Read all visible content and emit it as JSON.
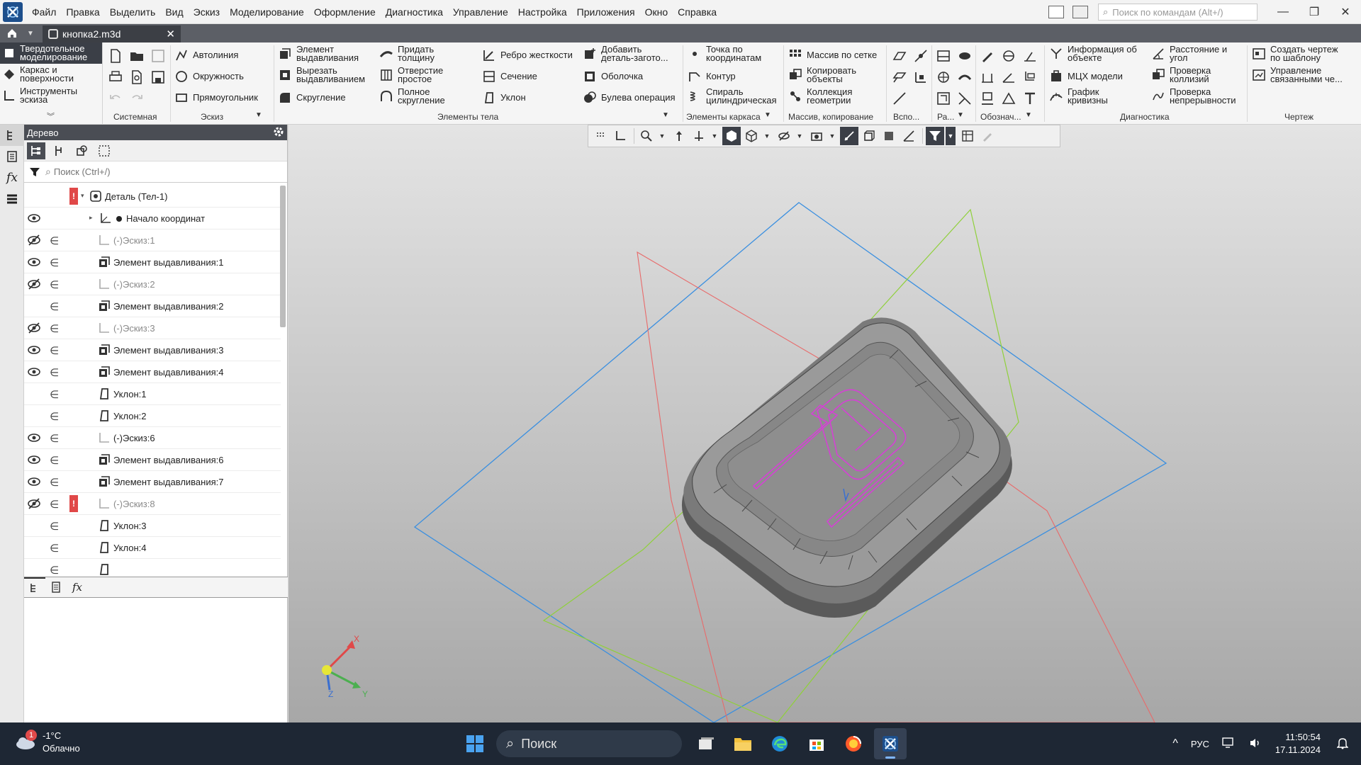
{
  "menu": {
    "items": [
      "Файл",
      "Правка",
      "Выделить",
      "Вид",
      "Эскиз",
      "Моделирование",
      "Оформление",
      "Диагностика",
      "Управление",
      "Настройка",
      "Приложения",
      "Окно",
      "Справка"
    ],
    "command_search_placeholder": "Поиск по командам (Alt+/)"
  },
  "tabs": {
    "document": "кнопка2.m3d"
  },
  "ribbon": {
    "modes": [
      "Твердотельное\nмоделирование",
      "Каркас и\nповерхности",
      "Инструменты\nэскиза"
    ],
    "groups": {
      "system": "Системная",
      "sketch": "Эскиз",
      "body": "Элементы тела",
      "frame": "Элементы каркаса",
      "array": "Массив, копирование",
      "aux": "Вспо...",
      "ra": "Ра...",
      "designations": "Обознач...",
      "diagnostics": "Диагностика",
      "drawing": "Чертеж"
    },
    "buttons": {
      "autoline": "Автолиния",
      "circle": "Окружность",
      "rectangle": "Прямоугольник",
      "extrude": "Элемент\nвыдавливания",
      "cut_extrude": "Вырезать\nвыдавливанием",
      "fillet": "Скругление",
      "thicken": "Придать\nтолщину",
      "hole": "Отверстие\nпростое",
      "full_fillet": "Полное\nскругление",
      "rib": "Ребро жесткости",
      "section": "Сечение",
      "draft": "Уклон",
      "add_blank": "Добавить\nдеталь-загото...",
      "shell": "Оболочка",
      "boolean": "Булева операция",
      "point_coords": "Точка по\nкоординатам",
      "contour": "Контур",
      "helix": "Спираль\nцилиндрическая",
      "grid_array": "Массив по сетке",
      "copy_objects": "Копировать\nобъекты",
      "geom_collection": "Коллекция\nгеометрии",
      "object_info": "Информация об\nобъекте",
      "mass_props": "МЦХ модели",
      "curvature_plot": "График\nкривизны",
      "distance_angle": "Расстояние и\nугол",
      "collision_check": "Проверка\nколлизий",
      "continuity_check": "Проверка\nнепрерывности",
      "create_drawing": "Создать чертеж\nпо шаблону",
      "manage_linked": "Управление\nсвязанными че..."
    }
  },
  "tree": {
    "title": "Дерево",
    "search_placeholder": "Поиск (Ctrl+/)",
    "rows": [
      {
        "label": "Деталь (Тел-1)",
        "eye": "none",
        "dep": false,
        "error": true,
        "dim": false,
        "icon": "part",
        "level": 0,
        "expander": "open"
      },
      {
        "label": "Начало координат",
        "eye": "visible",
        "dep": false,
        "error": false,
        "dim": false,
        "icon": "origin",
        "level": 1,
        "expander": "closed"
      },
      {
        "label": "(-)Эскиз:1",
        "eye": "hidden",
        "dep": true,
        "error": false,
        "dim": true,
        "icon": "sketch",
        "level": 1,
        "expander": "none"
      },
      {
        "label": "Элемент выдавливания:1",
        "eye": "visible",
        "dep": true,
        "error": false,
        "dim": false,
        "icon": "extrude",
        "level": 1,
        "expander": "none"
      },
      {
        "label": "(-)Эскиз:2",
        "eye": "hidden",
        "dep": true,
        "error": false,
        "dim": true,
        "icon": "sketch",
        "level": 1,
        "expander": "none"
      },
      {
        "label": "Элемент выдавливания:2",
        "eye": "none",
        "dep": true,
        "error": false,
        "dim": false,
        "icon": "extrude",
        "level": 1,
        "expander": "none"
      },
      {
        "label": "(-)Эскиз:3",
        "eye": "hidden",
        "dep": true,
        "error": false,
        "dim": true,
        "icon": "sketch",
        "level": 1,
        "expander": "none"
      },
      {
        "label": "Элемент выдавливания:3",
        "eye": "visible",
        "dep": true,
        "error": false,
        "dim": false,
        "icon": "extrude",
        "level": 1,
        "expander": "none"
      },
      {
        "label": "Элемент выдавливания:4",
        "eye": "visible",
        "dep": true,
        "error": false,
        "dim": false,
        "icon": "extrude",
        "level": 1,
        "expander": "none"
      },
      {
        "label": "Уклон:1",
        "eye": "none",
        "dep": true,
        "error": false,
        "dim": false,
        "icon": "draft",
        "level": 1,
        "expander": "none"
      },
      {
        "label": "Уклон:2",
        "eye": "none",
        "dep": true,
        "error": false,
        "dim": false,
        "icon": "draft",
        "level": 1,
        "expander": "none"
      },
      {
        "label": "(-)Эскиз:6",
        "eye": "visible",
        "dep": true,
        "error": false,
        "dim": false,
        "icon": "sketch",
        "level": 1,
        "expander": "none"
      },
      {
        "label": "Элемент выдавливания:6",
        "eye": "visible",
        "dep": true,
        "error": false,
        "dim": false,
        "icon": "extrude",
        "level": 1,
        "expander": "none"
      },
      {
        "label": "Элемент выдавливания:7",
        "eye": "visible",
        "dep": true,
        "error": false,
        "dim": false,
        "icon": "extrude",
        "level": 1,
        "expander": "none"
      },
      {
        "label": "(-)Эскиз:8",
        "eye": "hidden",
        "dep": true,
        "error": true,
        "dim": true,
        "icon": "sketch",
        "level": 1,
        "expander": "none"
      },
      {
        "label": "Уклон:3",
        "eye": "none",
        "dep": true,
        "error": false,
        "dim": false,
        "icon": "draft",
        "level": 1,
        "expander": "none"
      },
      {
        "label": "Уклон:4",
        "eye": "none",
        "dep": true,
        "error": false,
        "dim": false,
        "icon": "draft",
        "level": 1,
        "expander": "none"
      },
      {
        "label": "",
        "eye": "none",
        "dep": true,
        "error": false,
        "dim": false,
        "icon": "draft",
        "level": 1,
        "expander": "none"
      }
    ]
  },
  "viewport": {
    "axes": {
      "x": "X",
      "y": "Y",
      "z": "Z"
    }
  },
  "taskbar": {
    "weather_temp": "-1°C",
    "weather_desc": "Облачно",
    "weather_badge": "1",
    "search": "Поиск",
    "lang": "РУС",
    "time": "11:50:54",
    "date": "17.11.2024"
  },
  "colors": {
    "plane_blue": "#3a8fe0",
    "plane_red": "#e86a6a",
    "plane_green": "#8fd03a",
    "sketch_magenta": "#d442d4",
    "accent_dark": "#3b3f47"
  }
}
